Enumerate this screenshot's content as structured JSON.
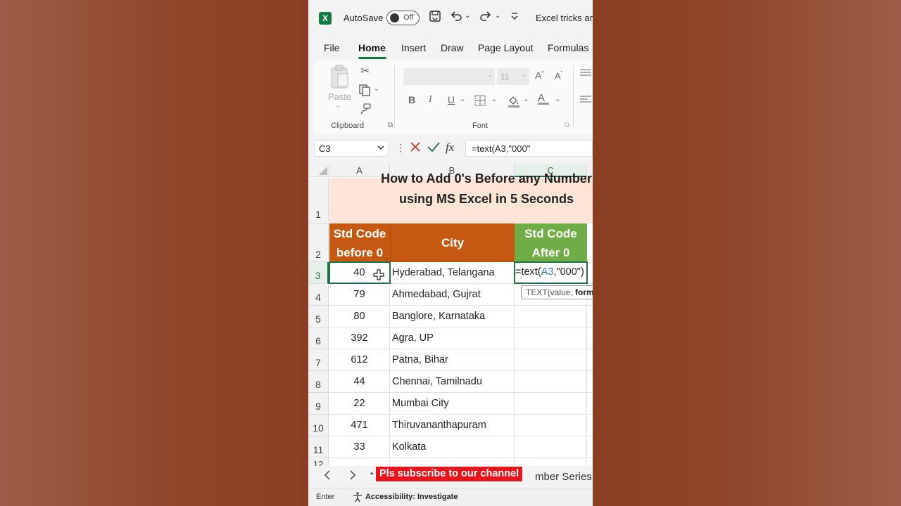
{
  "titlebar": {
    "app_logo": "X",
    "autosave_label": "AutoSave",
    "autosave_state": "Off",
    "doc_title": "Excel tricks an..."
  },
  "ribbon_tabs": [
    "File",
    "Home",
    "Insert",
    "Draw",
    "Page Layout",
    "Formulas"
  ],
  "ribbon": {
    "paste_label": "Paste",
    "clipboard_label": "Clipboard",
    "font_label": "Font",
    "font_size": "11",
    "bold": "B",
    "italic": "I",
    "underline": "U"
  },
  "formula_bar": {
    "name_box": "C3",
    "fx": "fx",
    "formula": "=text(A3,\"000\""
  },
  "columns": [
    "A",
    "B",
    "C"
  ],
  "sheet": {
    "title_line1": "How to Add 0's Before any Number",
    "title_line2": "using MS Excel in 5 Seconds",
    "header_a_line1": "Std Code",
    "header_a_line2": "before 0",
    "header_b": "City",
    "header_c_line1": "Std Code",
    "header_c_line2": "After 0",
    "rows": [
      {
        "num": "3",
        "code": "40",
        "city": "Hyderabad, Telangana"
      },
      {
        "num": "4",
        "code": "79",
        "city": "Ahmedabad, Gujrat"
      },
      {
        "num": "5",
        "code": "80",
        "city": "Banglore, Karnataka"
      },
      {
        "num": "6",
        "code": "392",
        "city": "Agra, UP"
      },
      {
        "num": "7",
        "code": "612",
        "city": "Patna, Bihar"
      },
      {
        "num": "8",
        "code": "44",
        "city": "Chennai, Tamilnadu"
      },
      {
        "num": "9",
        "code": "22",
        "city": "Mumbai City"
      },
      {
        "num": "10",
        "code": "471",
        "city": "Thiruvananthapuram"
      },
      {
        "num": "11",
        "code": "33",
        "city": "Kolkata"
      }
    ],
    "row_numbers_top": [
      "1",
      "2"
    ],
    "partial_row": "12",
    "c3_formula_prefix": "=text(",
    "c3_formula_ref": "A3",
    "c3_formula_suffix": ",\"000\")",
    "tooltip_prefix": "TEXT(value, ",
    "tooltip_bold": "form"
  },
  "sheet_bar": {
    "banner": "Pls subscribe to our channel",
    "sheet_tab": "mber Series"
  },
  "status": {
    "mode": "Enter",
    "accessibility": "Accessibility: Investigate"
  },
  "colors": {
    "excel_green": "#107c41",
    "title_fill": "#fce4d6",
    "orange_header": "#c65911",
    "green_header": "#70ad47",
    "banner_red": "#e8141c"
  }
}
